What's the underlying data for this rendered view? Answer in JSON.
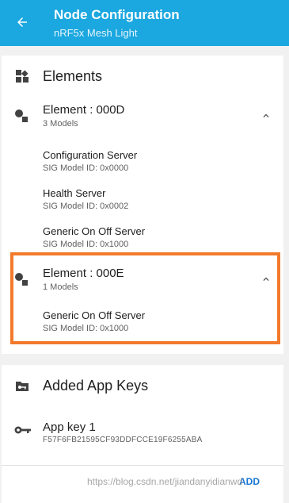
{
  "appbar": {
    "title": "Node Configuration",
    "subtitle": "nRF5x Mesh Light"
  },
  "elements_section": {
    "title": "Elements",
    "elements": [
      {
        "title": "Element : 000D",
        "subtitle": "3 Models",
        "models": [
          {
            "name": "Configuration Server",
            "id": "SIG Model ID: 0x0000"
          },
          {
            "name": "Health Server",
            "id": "SIG Model ID: 0x0002"
          },
          {
            "name": "Generic On Off Server",
            "id": "SIG Model ID: 0x1000"
          }
        ]
      },
      {
        "title": "Element : 000E",
        "subtitle": "1 Models",
        "models": [
          {
            "name": "Generic On Off Server",
            "id": "SIG Model ID: 0x1000"
          }
        ]
      }
    ]
  },
  "app_keys_section": {
    "title": "Added App Keys",
    "keys": [
      {
        "title": "App key 1",
        "value": "F57F6FB21595CF93DDFCCE19F6255ABA"
      }
    ],
    "add_label": "ADD"
  },
  "watermark": "https://blog.csdn.net/jiandanyidianwd",
  "colors": {
    "appbar": "#1ba7df",
    "highlight": "#f27a2c",
    "accent": "#1976d2"
  }
}
